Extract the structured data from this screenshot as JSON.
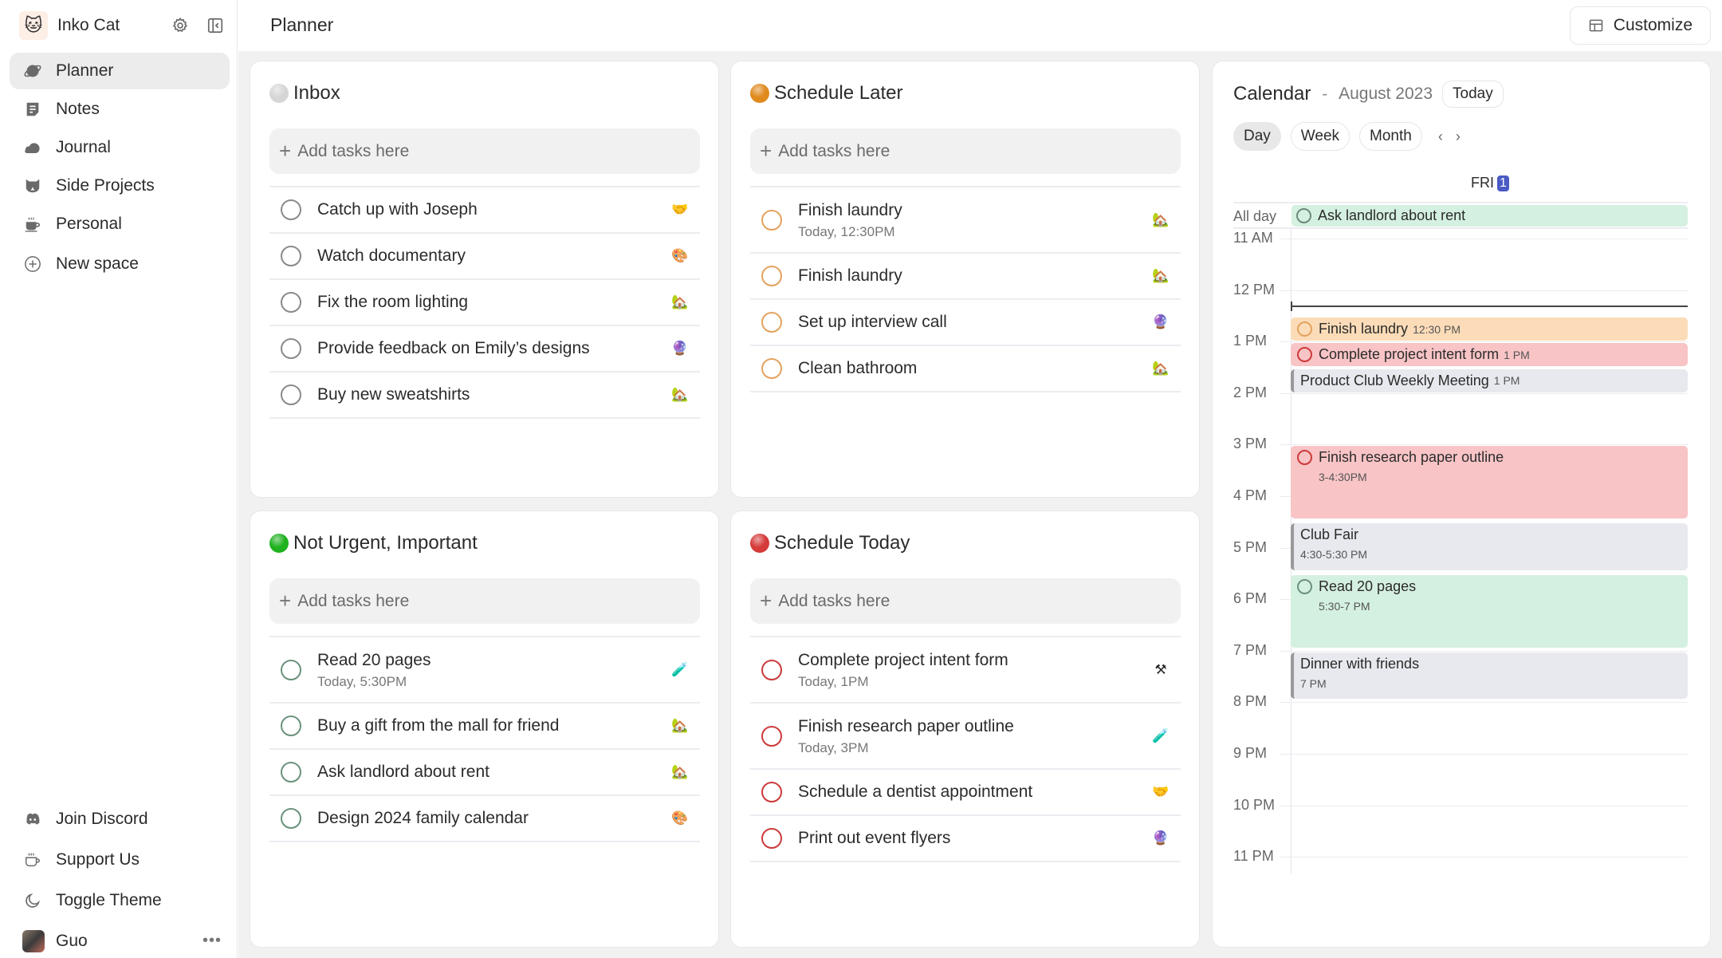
{
  "sidebar": {
    "workspace_name": "Inko Cat",
    "workspace_icon": "cat-icon",
    "items": [
      {
        "label": "Planner",
        "icon": "planet-icon",
        "active": true
      },
      {
        "label": "Notes",
        "icon": "note-icon"
      },
      {
        "label": "Journal",
        "icon": "cloud-icon"
      },
      {
        "label": "Side Projects",
        "icon": "cat-face-icon"
      },
      {
        "label": "Personal",
        "icon": "coffee-icon"
      },
      {
        "label": "New space",
        "icon": "plus-circle-icon"
      }
    ],
    "bottom": [
      {
        "label": "Join Discord",
        "icon": "discord-icon"
      },
      {
        "label": "Support Us",
        "icon": "cup-icon"
      },
      {
        "label": "Toggle Theme",
        "icon": "moon-icon"
      }
    ],
    "user": {
      "name": "Guo",
      "more": "•••"
    }
  },
  "header": {
    "title": "Planner",
    "customize_label": "Customize"
  },
  "quadrants": {
    "inbox": {
      "title": "Inbox",
      "dot_color": "#d6d6d6",
      "check_color": "#8a8a8a",
      "add_placeholder": "Add tasks here",
      "tasks": [
        {
          "title": "Catch up with Joseph",
          "emoji": "🤝"
        },
        {
          "title": "Watch documentary",
          "emoji": "🎨"
        },
        {
          "title": "Fix the room lighting",
          "emoji": "🏡"
        },
        {
          "title": "Provide feedback on Emily’s designs",
          "emoji": "🔮"
        },
        {
          "title": "Buy new sweatshirts",
          "emoji": "🏡"
        }
      ]
    },
    "later": {
      "title": "Schedule Later",
      "dot_color": "#e08a1e",
      "check_color": "#e3a25e",
      "add_placeholder": "Add tasks here",
      "tasks": [
        {
          "title": "Finish laundry",
          "sub": "Today, 12:30PM",
          "emoji": "🏡"
        },
        {
          "title": "Finish laundry",
          "emoji": "🏡"
        },
        {
          "title": "Set up interview call",
          "emoji": "🔮"
        },
        {
          "title": "Clean bathroom",
          "emoji": "🏡"
        }
      ]
    },
    "not_urgent_important": {
      "title": "Not Urgent, Important",
      "dot_color": "#1fb21f",
      "check_color": "#6a927c",
      "add_placeholder": "Add tasks here",
      "tasks": [
        {
          "title": "Read 20 pages",
          "sub": "Today, 5:30PM",
          "emoji": "🧪"
        },
        {
          "title": "Buy a gift from the mall for friend",
          "emoji": "🏡"
        },
        {
          "title": "Ask landlord about rent",
          "emoji": "🏡"
        },
        {
          "title": "Design 2024 family calendar",
          "emoji": "🎨"
        }
      ]
    },
    "today": {
      "title": "Schedule Today",
      "dot_color": "#d63a3a",
      "check_color": "#cc3a3a",
      "add_placeholder": "Add tasks here",
      "tasks": [
        {
          "title": "Complete project intent form",
          "sub": "Today, 1PM",
          "emoji": "⚒"
        },
        {
          "title": "Finish research paper outline",
          "sub": "Today, 3PM",
          "emoji": "🧪"
        },
        {
          "title": "Schedule a dentist appointment",
          "emoji": "🤝"
        },
        {
          "title": "Print out event flyers",
          "emoji": "🔮"
        }
      ]
    }
  },
  "calendar": {
    "title": "Calendar",
    "separator": "-",
    "month": "August 2023",
    "today_label": "Today",
    "views": [
      {
        "label": "Day",
        "active": true
      },
      {
        "label": "Week"
      },
      {
        "label": "Month"
      }
    ],
    "prev": "‹",
    "next": "›",
    "day_name": "FRI",
    "day_number": "1",
    "allday_label": "All day",
    "allday_event": "Ask landlord about rent",
    "hours": [
      "11 AM",
      "12 PM",
      "1 PM",
      "2 PM",
      "3 PM",
      "4 PM",
      "5 PM",
      "6 PM",
      "7 PM",
      "8 PM",
      "9 PM",
      "10 PM",
      "11 PM"
    ],
    "first_hour": 11,
    "now_hour": 12.3,
    "events": [
      {
        "title": "Finish laundry",
        "time": "12:30 PM",
        "start": 12.5,
        "end": 13.0,
        "kind": "task",
        "bg": "#fcdcb8",
        "check": "#e3a25e",
        "inline": true
      },
      {
        "title": "Complete project intent form",
        "time": "1 PM",
        "start": 13.0,
        "end": 13.5,
        "kind": "task",
        "bg": "#f8c4c6",
        "check": "#cc3a3a",
        "inline": true
      },
      {
        "title": "Product Club Weekly Meeting",
        "time": "1 PM",
        "start": 13.5,
        "end": 14.0,
        "kind": "event",
        "bg": "#e8e9ee",
        "inline": true
      },
      {
        "title": "Finish research paper outline",
        "time": "3-4:30PM",
        "start": 15.0,
        "end": 16.45,
        "kind": "task",
        "bg": "#f8c4c6",
        "check": "#cc3a3a"
      },
      {
        "title": "Club Fair",
        "time": "4:30-5:30 PM",
        "start": 16.5,
        "end": 17.45,
        "kind": "event",
        "bg": "#e8e9ee"
      },
      {
        "title": "Read 20 pages",
        "time": "5:30-7 PM",
        "start": 17.5,
        "end": 18.95,
        "kind": "task",
        "bg": "#d4f0e0",
        "check": "#6a927c"
      },
      {
        "title": "Dinner with friends",
        "time": "7 PM",
        "start": 19.0,
        "end": 19.95,
        "kind": "event",
        "bg": "#e8e9ee"
      }
    ]
  }
}
